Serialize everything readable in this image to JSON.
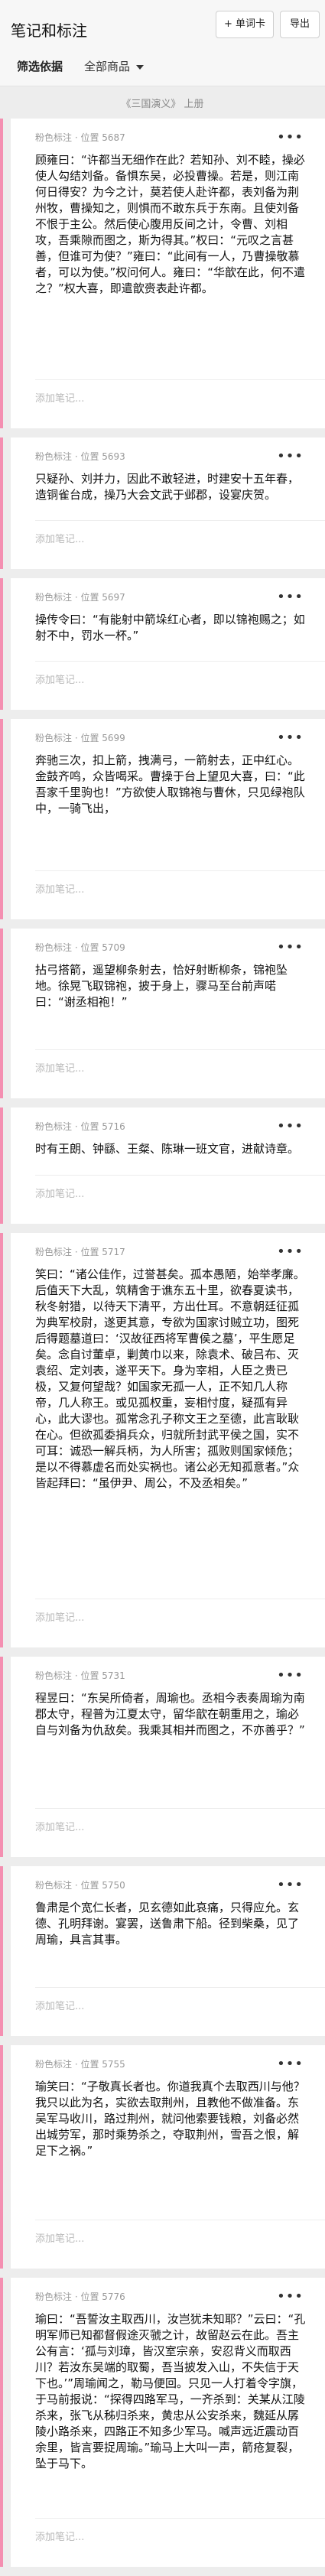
{
  "header": {
    "title": "笔记和标注",
    "word_card_label": "+ 单词卡",
    "export_label": "导出"
  },
  "filters": {
    "by_label": "筛选依据",
    "all_label": "全部商品"
  },
  "section": {
    "title": "《三国演义》 上册"
  },
  "note_placeholder": "添加笔记...",
  "cards": [
    {
      "meta": "粉色标注 · 位置 5687",
      "text": "顾雍曰：“许都当无细作在此？若知孙、刘不睦，操必使人勾结刘备。备惧东吴，必投曹操。若是，则江南何日得安？为今之计，莫若使人赴许都，表刘备为荆州牧，曹操知之，则惧而不敢东兵于东南。且使刘备不恨于主公。然后使心腹用反间之计，令曹、刘相攻，吾乘隙而图之，斯为得其。”权曰：“元叹之言甚善，但谁可为使？”雍曰：“此间有一人，乃曹操敬慕者，可以为使。”权问何人。雍曰：“华歆在此，何不遣之？”权大喜，即遣歆赍表赴许都。"
    },
    {
      "meta": "粉色标注 · 位置 5693",
      "text": "只疑孙、刘并力，因此不敢轻进，时建安十五年春，造铜雀台成，操乃大会文武于邺郡，设宴庆贺。"
    },
    {
      "meta": "粉色标注 · 位置 5697",
      "text": "操传令曰：“有能射中箭垛红心者，即以锦袍赐之；如射不中，罚水一杯。”"
    },
    {
      "meta": "粉色标注 · 位置 5699",
      "text": "奔驰三次，扣上箭，拽满弓，一箭射去，正中红心。金鼓齐鸣，众皆喝采。曹操于台上望见大喜，曰：“此吾家千里驹也！”方欲使人取锦袍与曹休，只见绿袍队中，一骑飞出，"
    },
    {
      "meta": "粉色标注 · 位置 5709",
      "text": "拈弓搭箭，遥望柳条射去，恰好射断柳条，锦袍坠地。徐晃飞取锦袍，披于身上，骤马至台前声喏曰：“谢丞相袍！”"
    },
    {
      "meta": "粉色标注 · 位置 5716",
      "text": "时有王朗、钟繇、王粲、陈琳一班文官，进献诗章。"
    },
    {
      "meta": "粉色标注 · 位置 5717",
      "text": "笑曰：“诸公佳作，过誉甚矣。孤本愚陋，始举孝廉。后值天下大乱，筑精舍于谯东五十里，欲春夏读书，秋冬射猎，以待天下清平，方出仕耳。不意朝廷征孤为典军校尉，遂更其意，专欲为国家讨贼立功，图死后得题墓道曰：‘汉故征西将军曹侯之墓’，平生愿足矣。念自讨董卓，剿黄巾以来，除袁术、破吕布、灭袁绍、定刘表，遂平天下。身为宰相，人臣之贵已极，又复何望哉？如国家无孤一人，正不知几人称帝，几人称王。或见孤权重，妄相忖度，疑孤有异心，此大谬也。孤常念孔子称文王之至德，此言耿耿在心。但欲孤委捐兵众，归就所封武平侯之国，实不可耳：诚恐一解兵柄，为人所害；孤败则国家倾危；是以不得慕虚名而处实祸也。诸公必无知孤意者。”众皆起拜曰：“虽伊尹、周公，不及丞相矣。”"
    },
    {
      "meta": "粉色标注 · 位置 5731",
      "text": "程昱曰：“东吴所倚者，周瑜也。丞相今表奏周瑜为南郡太守，程普为江夏太守，留华歆在朝重用之，瑜必自与刘备为仇敌矣。我乘其相并而图之，不亦善乎？”"
    },
    {
      "meta": "粉色标注 · 位置 5750",
      "text": "鲁肃是个宽仁长者，见玄德如此哀痛，只得应允。玄德、孔明拜谢。宴罢，送鲁肃下船。径到柴桑，见了周瑜，具言其事。"
    },
    {
      "meta": "粉色标注 · 位置 5755",
      "text": "瑜笑曰：“子敬真长者也。你道我真个去取西川与他？我只以此为名，实欲去取荆州，且教他不做准备。东吴军马收川，路过荆州，就问他索要钱粮，刘备必然出城劳军，那时乘势杀之，夺取荆州，雪吾之恨，解足下之祸。”"
    },
    {
      "meta": "粉色标注 · 位置 5776",
      "text": "瑜曰：“吾誓汝主取西川，汝岂犹未知耶？”云曰：“孔明军师已知都督假途灭虢之计，故留赵云在此。吾主公有言：‘孤与刘璋，皆汉室宗亲，安忍背义而取西川？若汝东吴端的取蜀，吾当披发入山，不失信于天下也。’”周瑜闻之，勒马便回。只见一人打着令字旗，于马前报说：“探得四路军马，一齐杀到：关某从江陵杀来，张飞从秭归杀来，黄忠从公安杀来，魏延从孱陵小路杀来，四路正不知多少军马。喊声远近震动百余里，皆言要捉周瑜。”瑜马上大叫一声，箭疮复裂，坠于马下。"
    }
  ]
}
